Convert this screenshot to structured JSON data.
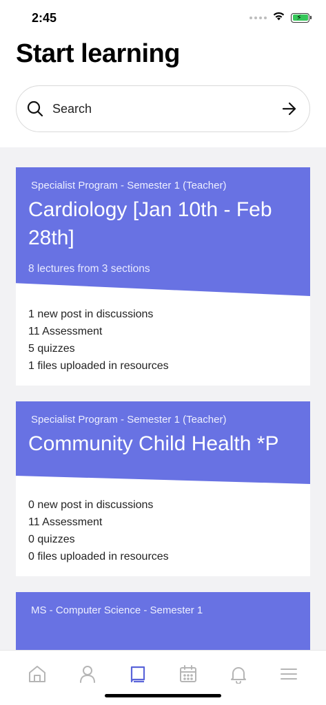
{
  "status_bar": {
    "time": "2:45"
  },
  "header": {
    "title": "Start learning"
  },
  "search": {
    "placeholder": "Search"
  },
  "courses": [
    {
      "program": "Specialist Program - Semester 1 (Teacher)",
      "title": "Cardiology [Jan 10th - Feb 28th]",
      "lectures": "8 lectures from 3 sections",
      "stats": [
        "1 new post in discussions",
        "11 Assessment",
        "5 quizzes",
        "1 files uploaded in resources"
      ]
    },
    {
      "program": "Specialist Program - Semester 1 (Teacher)",
      "title": "Community Child Health *P",
      "lectures": "",
      "stats": [
        "0 new post in discussions",
        "11 Assessment",
        "0 quizzes",
        "0 files uploaded in resources"
      ]
    },
    {
      "program": "MS - Computer Science - Semester 1",
      "title": "",
      "lectures": "",
      "stats": []
    }
  ],
  "tab_bar": {
    "items": [
      {
        "icon": "home-icon",
        "active": false
      },
      {
        "icon": "profile-icon",
        "active": false
      },
      {
        "icon": "book-icon",
        "active": true
      },
      {
        "icon": "calendar-icon",
        "active": false
      },
      {
        "icon": "bell-icon",
        "active": false
      },
      {
        "icon": "menu-icon",
        "active": false
      }
    ]
  },
  "colors": {
    "accent": "#6872e3",
    "active_tab": "#5a64d9",
    "inactive_tab": "#b5b5b5",
    "list_background": "#f2f2f4"
  }
}
